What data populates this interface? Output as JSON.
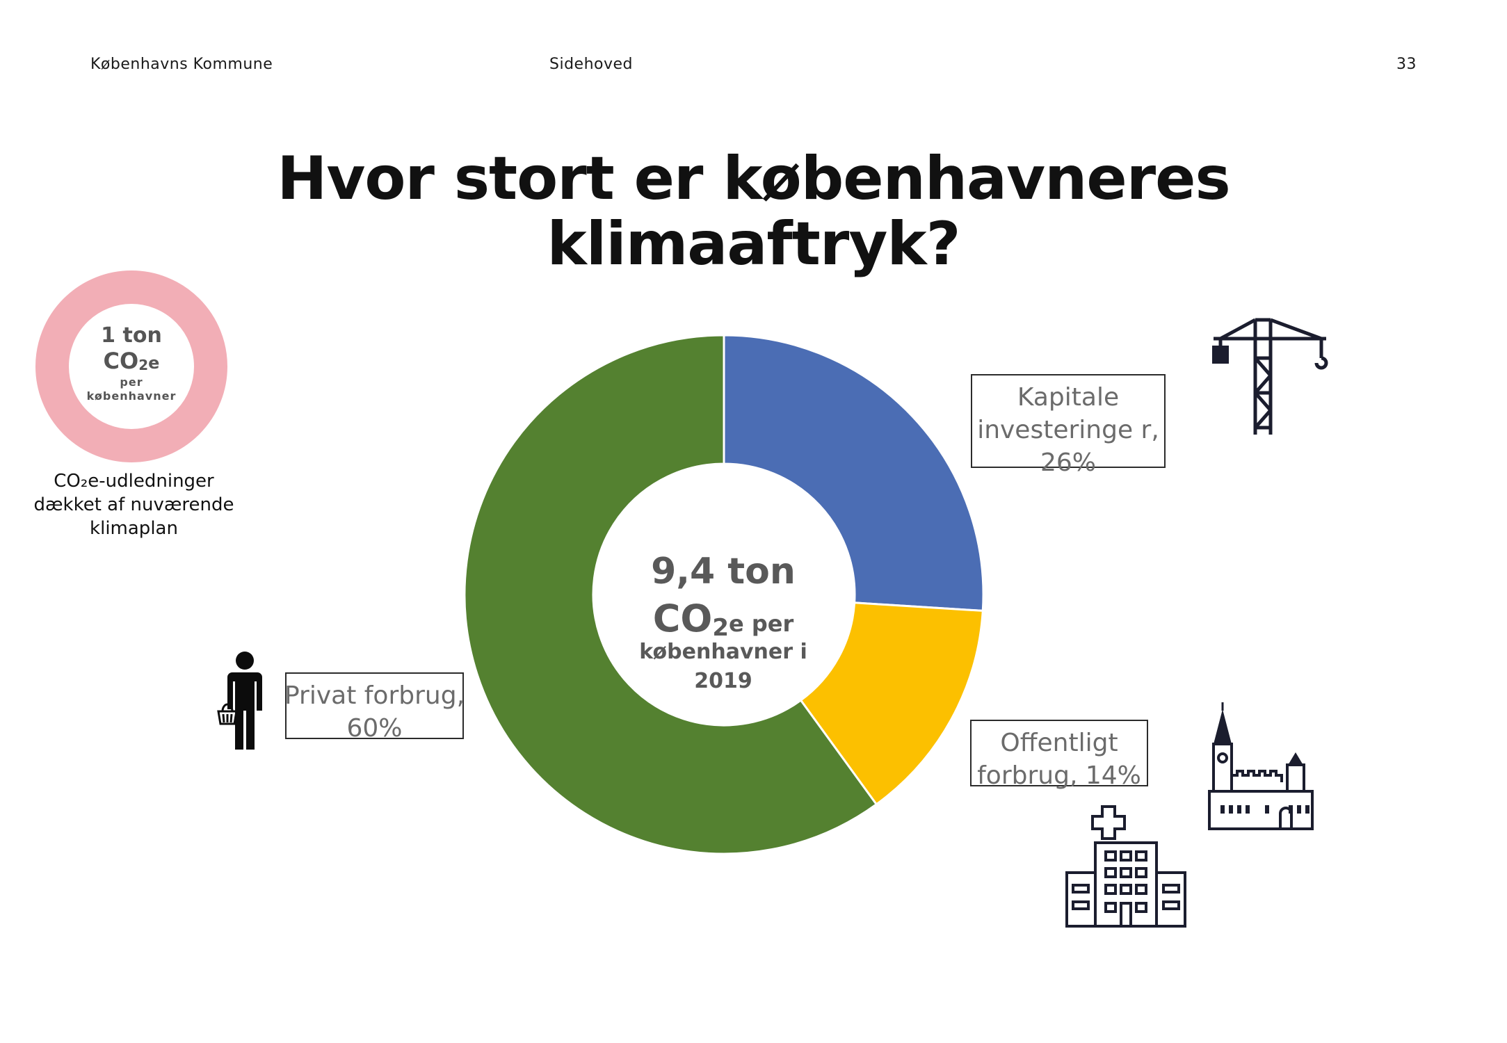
{
  "header": {
    "left": "Københavns Kommune",
    "center": "Sidehoved",
    "page_number": "33"
  },
  "title": {
    "line1": "Hvor stort er københavneres",
    "line2": "klimaaftryk?"
  },
  "mini_ring": {
    "line1": "1 ton",
    "line2_main": "CO",
    "line2_sub": "2",
    "line2_end": "e",
    "line3": "per",
    "line4": "københavner",
    "color": "#f2aeb6",
    "caption_line1": "CO₂e-udledninger",
    "caption_line2": "dækket af nuværende",
    "caption_line3": "klimaplan"
  },
  "donut_center": {
    "line1": "9,4 ton",
    "line2_main": "CO",
    "line2_sub": "2",
    "line2_end": "e per",
    "line3": "københavner i",
    "line4": "2019"
  },
  "labels": {
    "kapital": "Kapitale investeringe r, 26%",
    "offentligt": "Offentligt forbrug, 14%",
    "privat": "Privat forbrug, 60%"
  },
  "icons": {
    "crane": "crane-icon",
    "church": "town-hall-icon",
    "hospital": "hospital-icon",
    "person": "shopper-icon"
  },
  "chart_data": {
    "type": "pie",
    "categories": [
      "Kapitale investeringer",
      "Offentligt forbrug",
      "Privat forbrug"
    ],
    "values": [
      26,
      14,
      60
    ],
    "unit": "%",
    "colors": [
      "#4b6db4",
      "#fcc000",
      "#548130"
    ],
    "title": "Hvor stort er københavneres klimaaftryk?"
  }
}
